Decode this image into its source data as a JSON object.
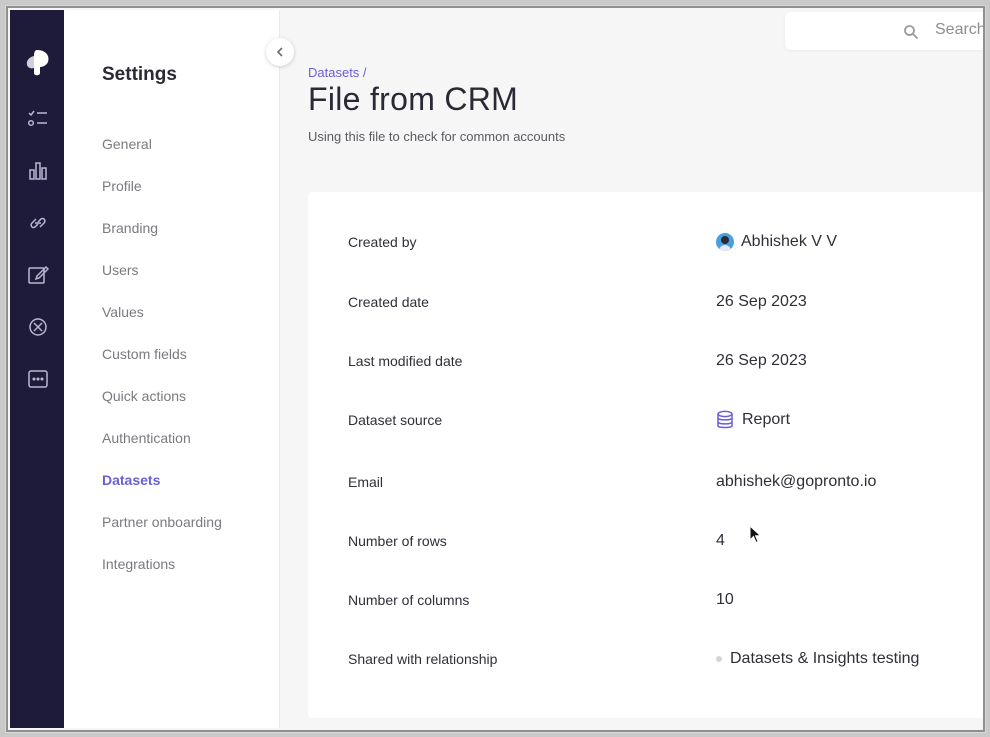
{
  "settings": {
    "title": "Settings",
    "nav": [
      {
        "label": "General"
      },
      {
        "label": "Profile"
      },
      {
        "label": "Branding"
      },
      {
        "label": "Users"
      },
      {
        "label": "Values"
      },
      {
        "label": "Custom fields"
      },
      {
        "label": "Quick actions"
      },
      {
        "label": "Authentication"
      },
      {
        "label": "Datasets",
        "active": true
      },
      {
        "label": "Partner onboarding"
      },
      {
        "label": "Integrations"
      }
    ]
  },
  "search": {
    "placeholder": "Search"
  },
  "header": {
    "breadcrumb": "Datasets /",
    "title": "File from CRM",
    "subtitle": "Using this file to check for common accounts"
  },
  "details": {
    "created_by": {
      "label": "Created by",
      "value": "Abhishek V V"
    },
    "created_date": {
      "label": "Created date",
      "value": "26 Sep 2023"
    },
    "last_modified": {
      "label": "Last modified date",
      "value": "26 Sep 2023"
    },
    "source": {
      "label": "Dataset source",
      "value": "Report"
    },
    "email": {
      "label": "Email",
      "value": "abhishek@gopronto.io"
    },
    "rows": {
      "label": "Number of rows",
      "value": "4"
    },
    "columns": {
      "label": "Number of columns",
      "value": "10"
    },
    "shared": {
      "label": "Shared with relationship",
      "value": "Datasets & Insights testing"
    }
  },
  "colors": {
    "accent": "#6a5fd6",
    "rail": "#1e1b3a"
  },
  "icons": [
    "logo-icon",
    "tasks-icon",
    "chart-icon",
    "link-icon",
    "edit-icon",
    "ban-icon",
    "more-icon",
    "chevron-left-icon",
    "search-icon",
    "database-icon",
    "mouse-cursor-icon"
  ]
}
